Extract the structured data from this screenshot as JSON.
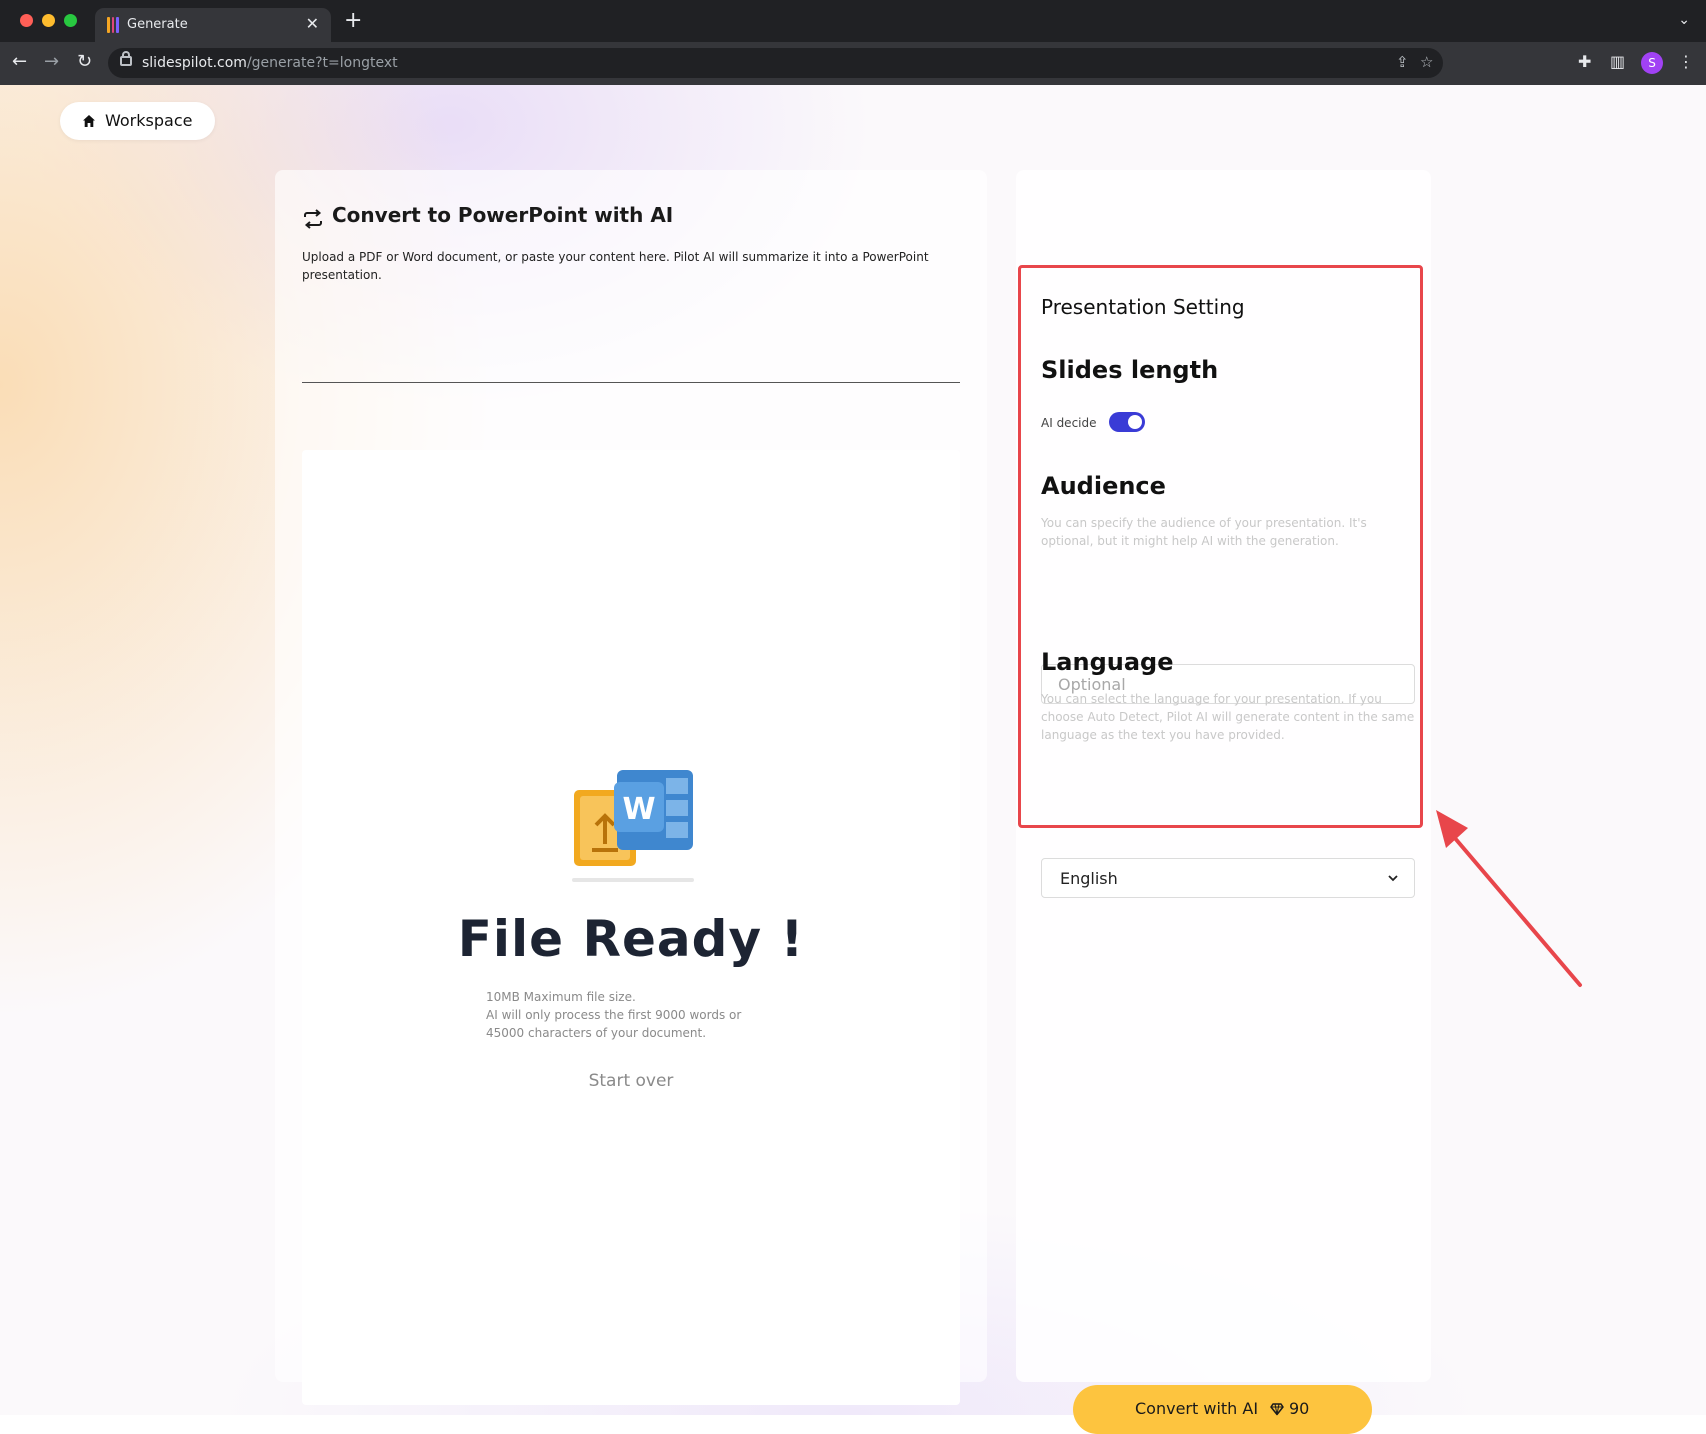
{
  "browser": {
    "tab_title": "Generate",
    "url_host": "slidespilot.com",
    "url_path": "/generate?t=longtext",
    "profile_initial": "S"
  },
  "header": {
    "workspace_label": "Workspace"
  },
  "converter": {
    "title": "Convert to PowerPoint with AI",
    "description": "Upload a PDF or Word document, or paste your content here. Pilot AI will summarize it into a PowerPoint presentation.",
    "status": "File Ready !",
    "note_line1": "10MB Maximum file size.",
    "note_line2": "AI will only process the first 9000 words or",
    "note_line3": "45000 characters of your document.",
    "start_over": "Start over"
  },
  "settings": {
    "heading": "Presentation Setting",
    "slides_length": {
      "title": "Slides length",
      "toggle_label": "AI decide",
      "toggle_on": true
    },
    "audience": {
      "title": "Audience",
      "description": "You can specify the audience of your presentation. It's optional, but it might help AI with the generation.",
      "placeholder": "Optional",
      "value": ""
    },
    "language": {
      "title": "Language",
      "description": "You can select the language for your presentation. If you choose Auto Detect, Pilot AI will generate content in the same language as the text you have provided.",
      "selected": "English"
    }
  },
  "action": {
    "convert_label": "Convert with AI",
    "credits": "90"
  },
  "colors": {
    "accent": "#3a3bd6",
    "button": "#fdc43f",
    "annotation": "#e8464b"
  }
}
